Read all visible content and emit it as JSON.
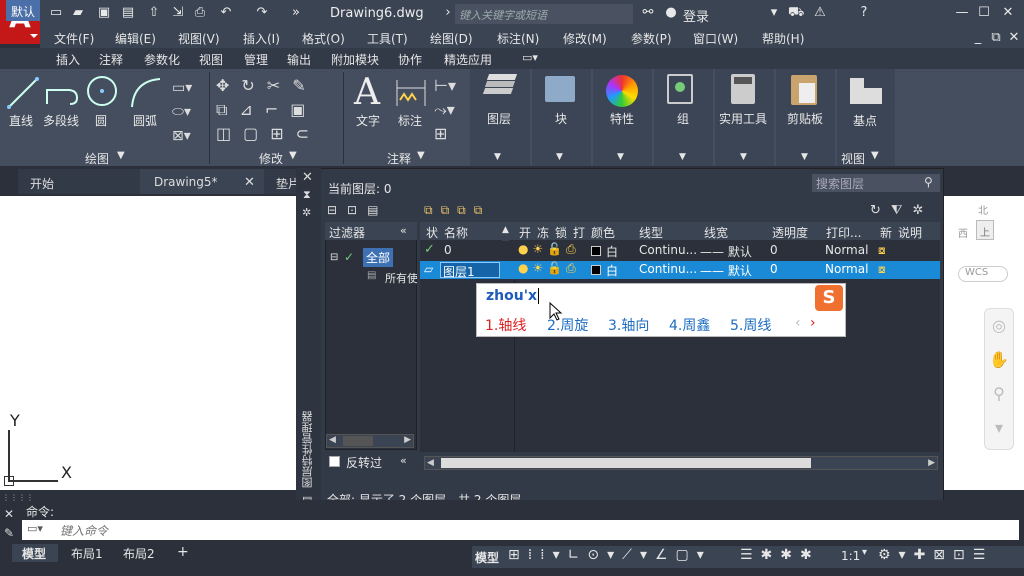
{
  "app": {
    "logo": "A",
    "title": "Drawing6.dwg",
    "search_placeholder": "键入关键字或短语",
    "login": "登录"
  },
  "menus": [
    "文件(F)",
    "编辑(E)",
    "视图(V)",
    "插入(I)",
    "格式(O)",
    "工具(T)",
    "绘图(D)",
    "标注(N)",
    "修改(M)",
    "参数(P)",
    "窗口(W)",
    "帮助(H)"
  ],
  "ribbon_tabs": [
    "默认",
    "插入",
    "注释",
    "参数化",
    "视图",
    "管理",
    "输出",
    "附加模块",
    "协作",
    "精选应用"
  ],
  "draw_panel": {
    "buttons": [
      "直线",
      "多段线",
      "圆",
      "圆弧"
    ],
    "label": "绘图"
  },
  "modify_panel": {
    "label": "修改"
  },
  "annot_panel": {
    "buttons": [
      "文字",
      "标注"
    ],
    "label": "注释"
  },
  "big_panels": [
    "图层",
    "块",
    "特性",
    "组",
    "实用工具",
    "剪贴板",
    "基点"
  ],
  "view_panel_label": "视图",
  "doc_tabs": [
    "开始",
    "Drawing5*",
    "垫片"
  ],
  "palette": {
    "current_layer": "当前图层: 0",
    "search_placeholder": "搜索图层",
    "filter_header": "过滤器",
    "filter_all": "全部",
    "filter_used": "所有使",
    "invert": "反转过",
    "side_title": "图层特性管理器",
    "status": "全部: 显示了 2 个图层，共 2 个图层",
    "columns": [
      "状",
      "名称",
      "开",
      "冻",
      "锁",
      "打",
      "颜色",
      "线型",
      "线宽",
      "透明度",
      "打印...",
      "新",
      "说明"
    ],
    "rows": [
      {
        "name": "0",
        "color": "白",
        "linetype": "Continu...",
        "lineweight": "—— 默认",
        "transparency": "0",
        "plot": "Normal"
      },
      {
        "name": "图层1",
        "color": "白",
        "linetype": "Continu...",
        "lineweight": "—— 默认",
        "transparency": "0",
        "plot": "Normal"
      }
    ]
  },
  "ime": {
    "input": "zhou'x",
    "candidates": [
      "1.轴线",
      "2.周旋",
      "3.轴向",
      "4.周鑫",
      "5.周线"
    ]
  },
  "viewcube": {
    "north": "北",
    "west": "西",
    "top": "上",
    "wcs": "WCS"
  },
  "axis": {
    "y": "Y",
    "x": "X"
  },
  "command": {
    "label": "命令:",
    "placeholder": "键入命令"
  },
  "layout_tabs": [
    "模型",
    "布局1",
    "布局2"
  ],
  "status_bar": {
    "model": "模型",
    "scale": "1:1"
  },
  "colors": {
    "accent": "#1a8ad6",
    "logo": "#c41818"
  }
}
